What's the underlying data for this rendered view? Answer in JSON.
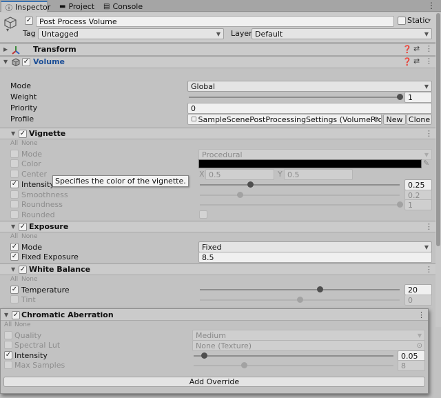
{
  "tabs": [
    {
      "label": "Inspector",
      "icon": "info-icon"
    },
    {
      "label": "Project",
      "icon": "folder-icon"
    },
    {
      "label": "Console",
      "icon": "console-icon"
    }
  ],
  "object": {
    "name": "Post Process Volume",
    "static_label": "Static",
    "tag_label": "Tag",
    "tag_value": "Untagged",
    "layer_label": "Layer",
    "layer_value": "Default",
    "active": true
  },
  "components": {
    "transform": "Transform",
    "volume": "Volume"
  },
  "volume": {
    "mode_label": "Mode",
    "mode_value": "Global",
    "weight_label": "Weight",
    "weight_value": "1",
    "priority_label": "Priority",
    "priority_value": "0",
    "profile_label": "Profile",
    "profile_value": "SampleScenePostProcessingSettings (VolumeProfile)",
    "new_label": "New",
    "clone_label": "Clone",
    "weight_fraction": 1.0
  },
  "all_label": "All",
  "none_label": "None",
  "vignette": {
    "title": "Vignette",
    "mode_label": "Mode",
    "mode_value": "Procedural",
    "color_label": "Color",
    "color_value": "#000000",
    "center_label": "Center",
    "x_label": "X",
    "x_value": "0.5",
    "y_label": "Y",
    "y_value": "0.5",
    "intensity_label": "Intensity",
    "intensity_value": "0.25",
    "smoothness_label": "Smoothness",
    "smoothness_value": "0.2",
    "roundness_label": "Roundness",
    "roundness_value": "1",
    "rounded_label": "Rounded",
    "tooltip": "Specifies the color of the vignette.",
    "intensity_fraction": 0.25,
    "smoothness_fraction": 0.2,
    "roundness_fraction": 1.0
  },
  "exposure": {
    "title": "Exposure",
    "mode_label": "Mode",
    "mode_value": "Fixed",
    "fixed_label": "Fixed Exposure",
    "fixed_value": "8.5"
  },
  "white_balance": {
    "title": "White Balance",
    "temp_label": "Temperature",
    "temp_value": "20",
    "tint_label": "Tint",
    "tint_value": "0",
    "temp_fraction": 0.6,
    "tint_fraction": 0.5
  },
  "chromatic": {
    "title": "Chromatic Aberration",
    "quality_label": "Quality",
    "quality_value": "Medium",
    "lut_label": "Spectral Lut",
    "lut_value": "None (Texture)",
    "intensity_label": "Intensity",
    "intensity_value": "0.05",
    "samples_label": "Max Samples",
    "samples_value": "8",
    "intensity_fraction": 0.05,
    "samples_fraction": 0.25
  },
  "add_override": "Add Override"
}
